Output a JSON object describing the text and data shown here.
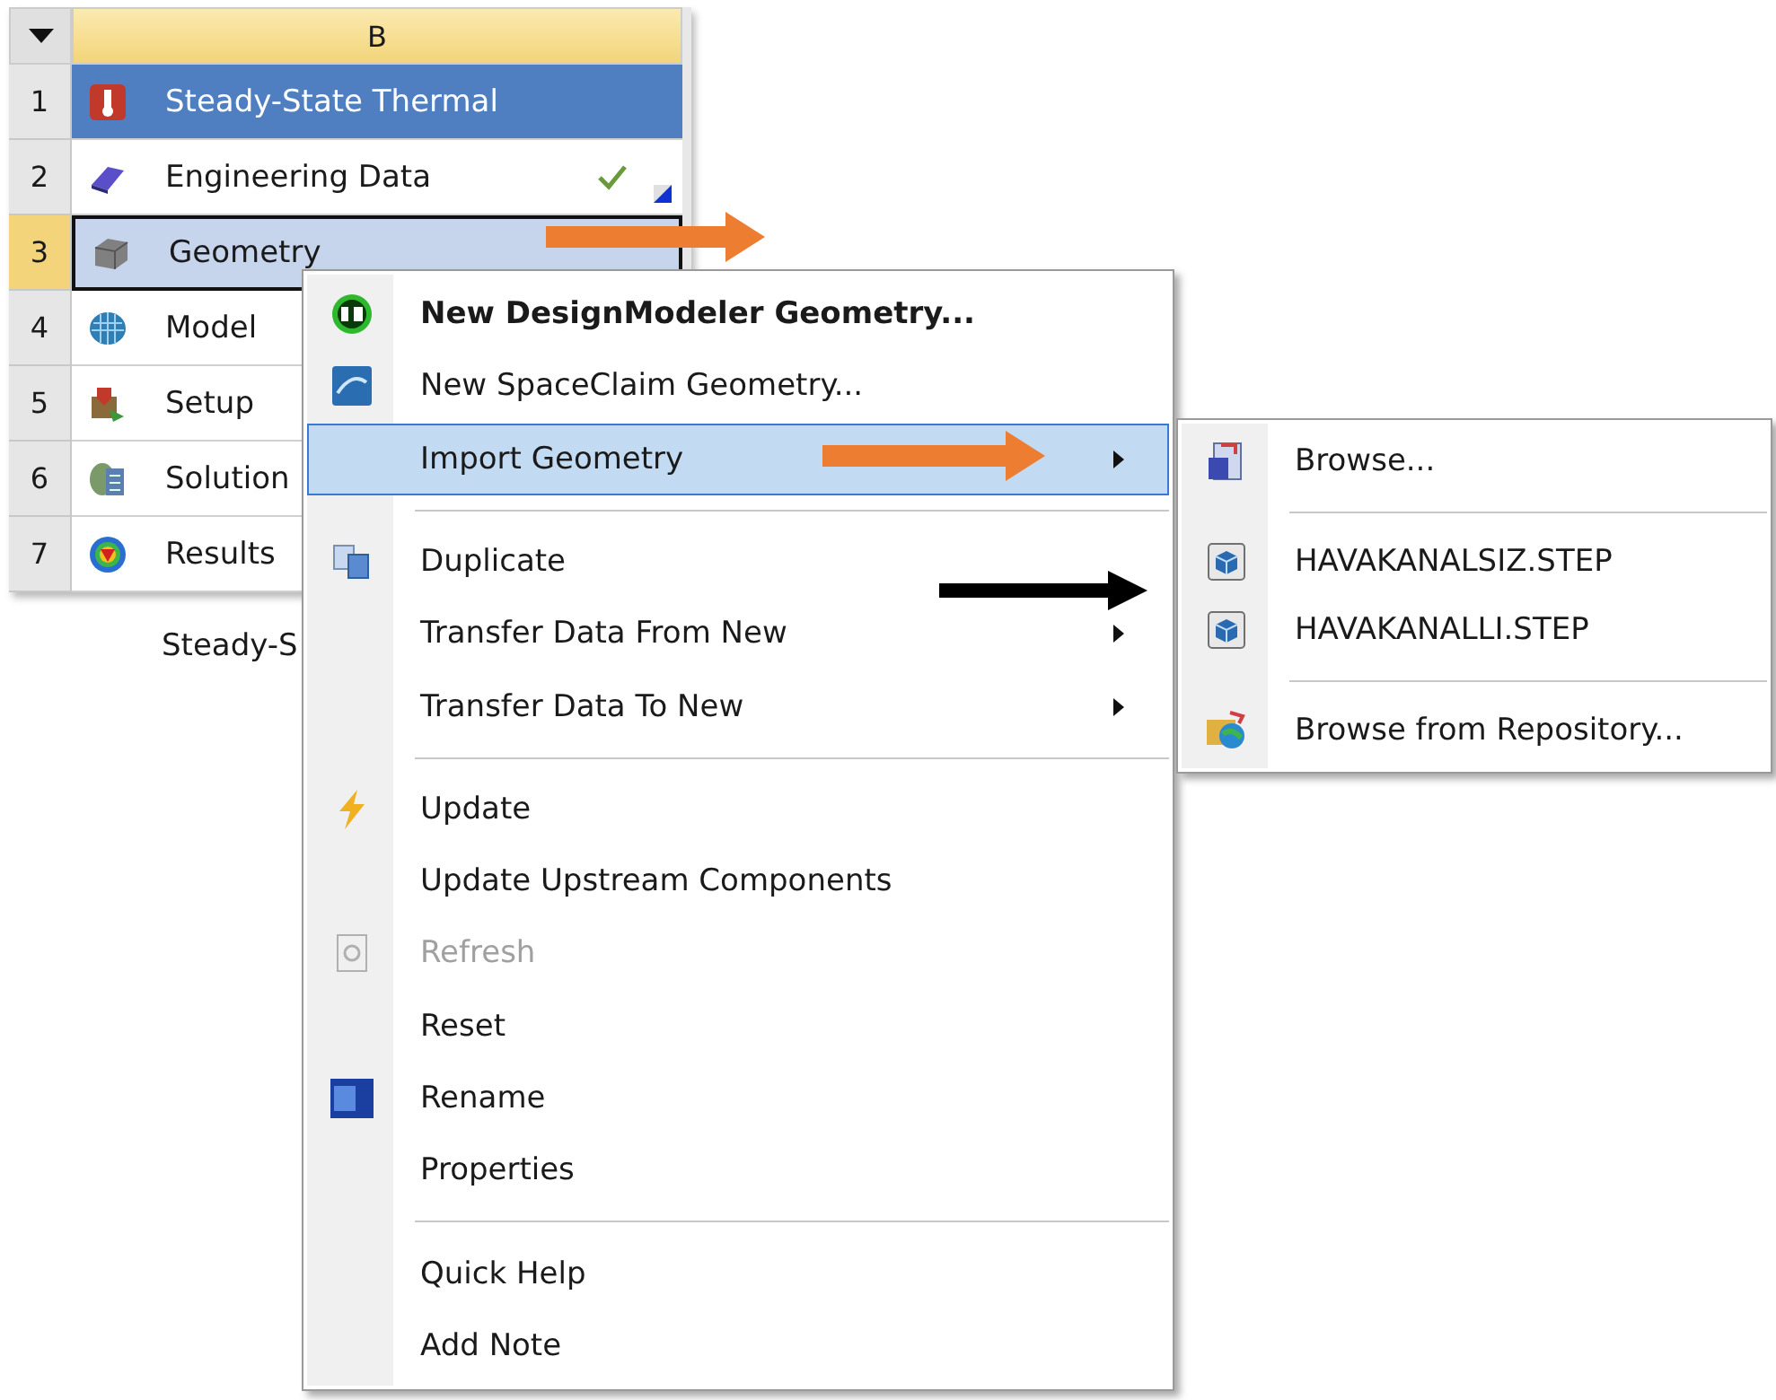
{
  "table": {
    "column_header": "B",
    "rows": [
      {
        "number": "1",
        "label": "Steady-State Thermal",
        "kind": "system",
        "selected": false,
        "up_to_date": false
      },
      {
        "number": "2",
        "label": "Engineering Data",
        "kind": "cell",
        "selected": false,
        "up_to_date": true
      },
      {
        "number": "3",
        "label": "Geometry",
        "kind": "cell",
        "selected": true,
        "up_to_date": false
      },
      {
        "number": "4",
        "label": "Model",
        "kind": "cell",
        "selected": false,
        "up_to_date": false
      },
      {
        "number": "5",
        "label": "Setup",
        "kind": "cell",
        "selected": false,
        "up_to_date": false
      },
      {
        "number": "6",
        "label": "Solution",
        "kind": "cell",
        "selected": false,
        "up_to_date": false
      },
      {
        "number": "7",
        "label": "Results",
        "kind": "cell",
        "selected": false,
        "up_to_date": false
      }
    ],
    "caption": "Steady-S"
  },
  "context_menu": {
    "items": [
      {
        "kind": "item",
        "label": "New DesignModeler Geometry...",
        "default": true,
        "selected": false,
        "disabled": false,
        "submenu": false
      },
      {
        "kind": "item",
        "label": "New SpaceClaim Geometry...",
        "default": false,
        "selected": false,
        "disabled": false,
        "submenu": false
      },
      {
        "kind": "item",
        "label": "Import Geometry",
        "default": false,
        "selected": true,
        "disabled": false,
        "submenu": true
      },
      {
        "kind": "separator"
      },
      {
        "kind": "item",
        "label": "Duplicate",
        "default": false,
        "selected": false,
        "disabled": false,
        "submenu": false
      },
      {
        "kind": "item",
        "label": "Transfer Data From New",
        "default": false,
        "selected": false,
        "disabled": false,
        "submenu": true
      },
      {
        "kind": "item",
        "label": "Transfer Data To New",
        "default": false,
        "selected": false,
        "disabled": false,
        "submenu": true
      },
      {
        "kind": "separator"
      },
      {
        "kind": "item",
        "label": "Update",
        "default": false,
        "selected": false,
        "disabled": false,
        "submenu": false
      },
      {
        "kind": "item",
        "label": "Update Upstream Components",
        "default": false,
        "selected": false,
        "disabled": false,
        "submenu": false
      },
      {
        "kind": "item",
        "label": "Refresh",
        "default": false,
        "selected": false,
        "disabled": true,
        "submenu": false
      },
      {
        "kind": "item",
        "label": "Reset",
        "default": false,
        "selected": false,
        "disabled": false,
        "submenu": false
      },
      {
        "kind": "item",
        "label": "Rename",
        "default": false,
        "selected": false,
        "disabled": false,
        "submenu": false
      },
      {
        "kind": "item",
        "label": "Properties",
        "default": false,
        "selected": false,
        "disabled": false,
        "submenu": false
      },
      {
        "kind": "separator"
      },
      {
        "kind": "item",
        "label": "Quick Help",
        "default": false,
        "selected": false,
        "disabled": false,
        "submenu": false
      },
      {
        "kind": "item",
        "label": "Add Note",
        "default": false,
        "selected": false,
        "disabled": false,
        "submenu": false
      }
    ]
  },
  "import_submenu": {
    "items": [
      {
        "kind": "item",
        "label": "Browse..."
      },
      {
        "kind": "separator"
      },
      {
        "kind": "item",
        "label": "HAVAKANALSIZ.STEP"
      },
      {
        "kind": "item",
        "label": "HAVAKANALLI.STEP"
      },
      {
        "kind": "separator"
      },
      {
        "kind": "item",
        "label": "Browse from Repository..."
      }
    ]
  }
}
